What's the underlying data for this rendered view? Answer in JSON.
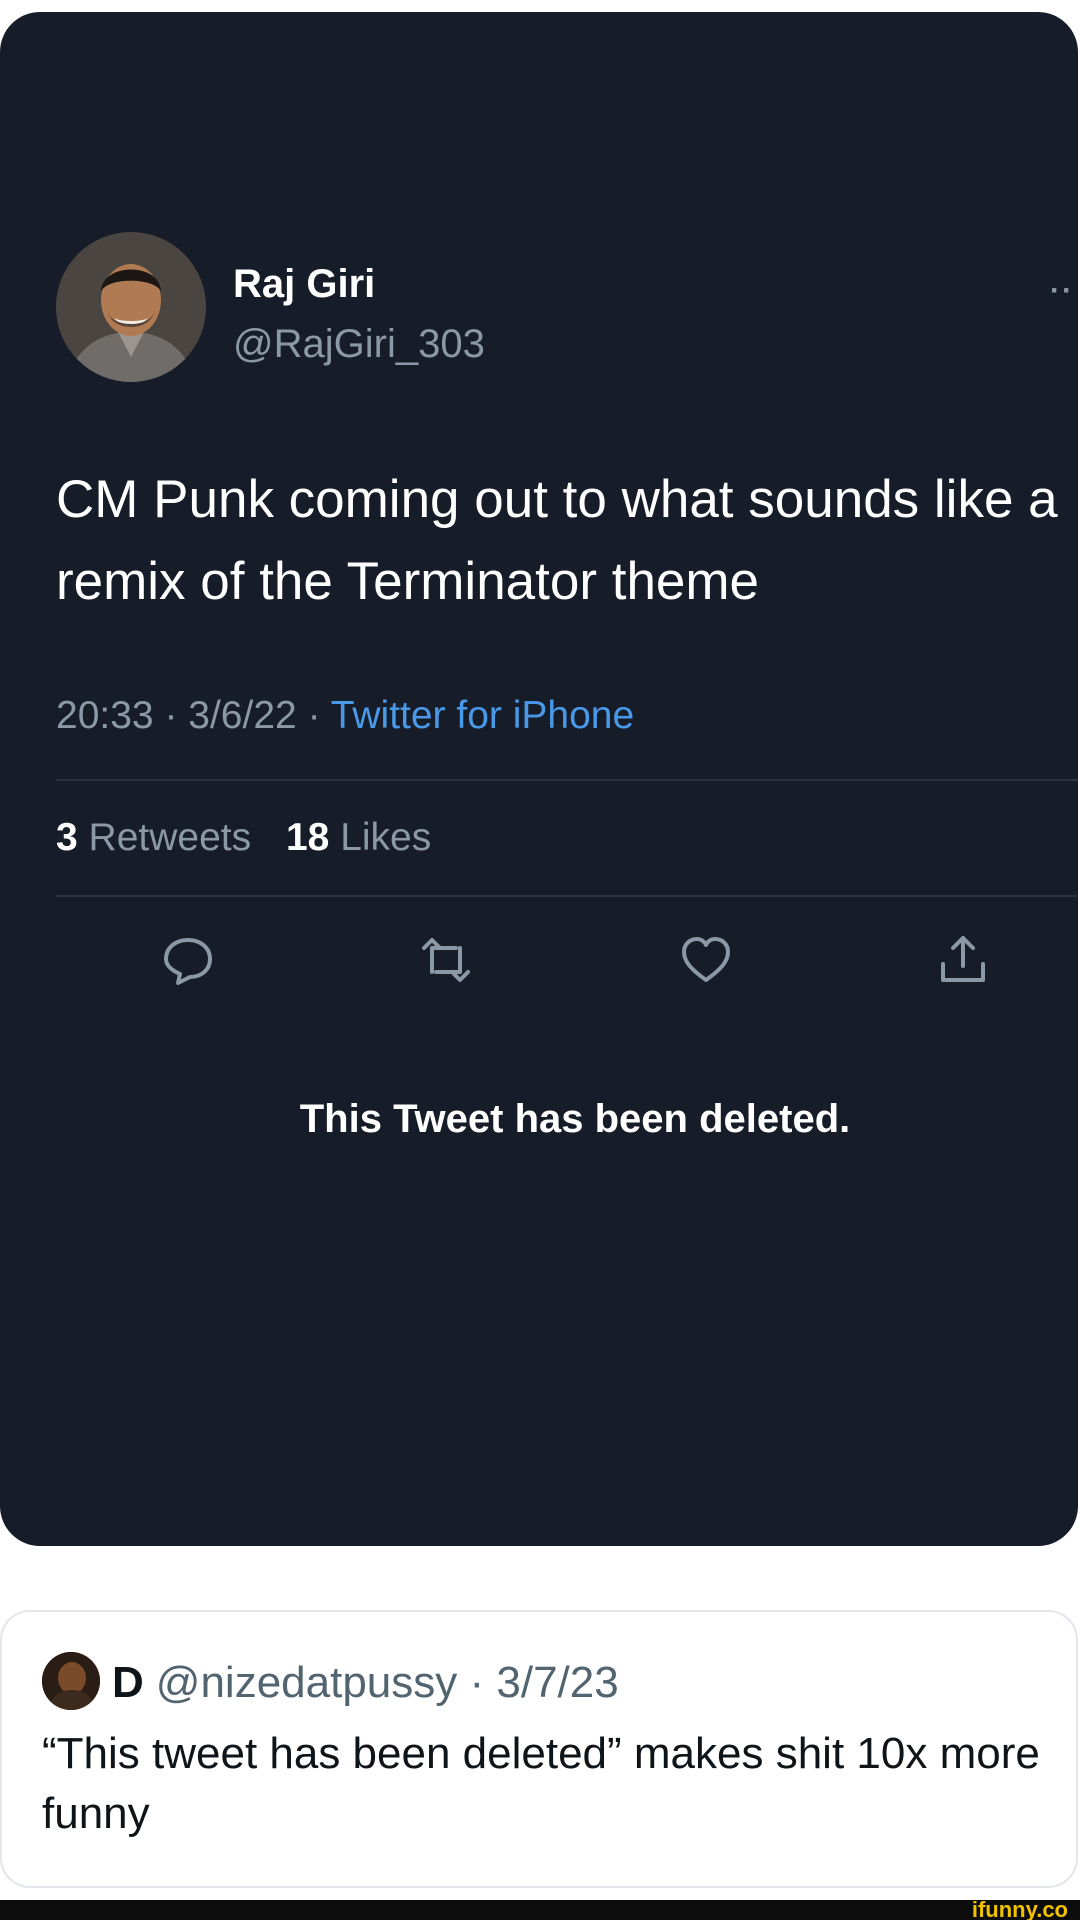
{
  "tweet": {
    "display_name": "Raj Giri",
    "handle": "@RajGiri_303",
    "more_label": "··",
    "text": "CM Punk coming out to what sounds like a remix of the Terminator theme",
    "time": "20:33",
    "date": "3/6/22",
    "source": "Twitter for iPhone",
    "retweets_count": "3",
    "retweets_label": "Retweets",
    "likes_count": "18",
    "likes_label": "Likes",
    "actions": [
      "reply-icon",
      "retweet-icon",
      "like-icon",
      "share-icon"
    ],
    "deleted_message": "This Tweet has been deleted."
  },
  "reply": {
    "name": "D",
    "handle": "@nizedatpussy",
    "date": "3/7/23",
    "text": "“This tweet has been deleted” makes shit 10x more funny"
  },
  "watermark": "ifunny.co",
  "colors": {
    "card_background": "#161c28",
    "link_blue": "#4a99e9",
    "muted_text": "#8b98a5",
    "watermark_yellow": "#f2c200"
  }
}
